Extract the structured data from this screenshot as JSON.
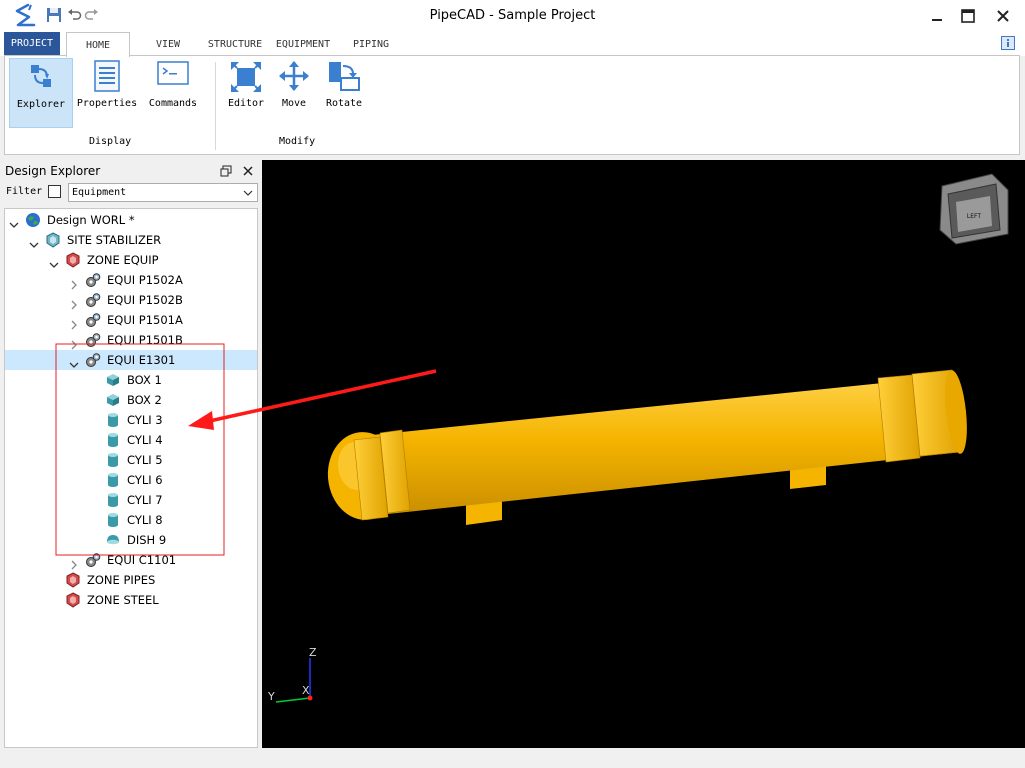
{
  "window": {
    "title": "PipeCAD - Sample Project"
  },
  "tabs": [
    {
      "label": "PROJECT"
    },
    {
      "label": "HOME"
    },
    {
      "label": "VIEW"
    },
    {
      "label": "STRUCTURE"
    },
    {
      "label": "EQUIPMENT"
    },
    {
      "label": "PIPING"
    }
  ],
  "ribbon": {
    "display_group": "Display",
    "modify_group": "Modify",
    "buttons": {
      "explorer": "Explorer",
      "properties": "Properties",
      "commands": "Commands",
      "editor": "Editor",
      "move": "Move",
      "rotate": "Rotate"
    }
  },
  "explorer": {
    "title": "Design Explorer",
    "filter_label": "Filter",
    "filter_value": "Equipment",
    "tree": [
      {
        "label": "Design WORL *",
        "icon": "globe-icon"
      },
      {
        "label": "SITE STABILIZER",
        "icon": "site-icon"
      },
      {
        "label": "ZONE EQUIP",
        "icon": "zone-icon"
      },
      {
        "label": "EQUI P1502A",
        "icon": "equipment-icon"
      },
      {
        "label": "EQUI P1502B",
        "icon": "equipment-icon"
      },
      {
        "label": "EQUI P1501A",
        "icon": "equipment-icon"
      },
      {
        "label": "EQUI P1501B",
        "icon": "equipment-icon"
      },
      {
        "label": "EQUI E1301",
        "icon": "equipment-icon"
      },
      {
        "label": "BOX 1",
        "icon": "box-icon"
      },
      {
        "label": "BOX 2",
        "icon": "box-icon"
      },
      {
        "label": "CYLI 3",
        "icon": "cylinder-icon"
      },
      {
        "label": "CYLI 4",
        "icon": "cylinder-icon"
      },
      {
        "label": "CYLI 5",
        "icon": "cylinder-icon"
      },
      {
        "label": "CYLI 6",
        "icon": "cylinder-icon"
      },
      {
        "label": "CYLI 7",
        "icon": "cylinder-icon"
      },
      {
        "label": "CYLI 8",
        "icon": "cylinder-icon"
      },
      {
        "label": "DISH 9",
        "icon": "dish-icon"
      },
      {
        "label": "EQUI C1101",
        "icon": "equipment-icon"
      },
      {
        "label": "ZONE PIPES",
        "icon": "zone-icon"
      },
      {
        "label": "ZONE STEEL",
        "icon": "zone-icon"
      }
    ]
  },
  "viewport": {
    "view_cube_label": "LEFT",
    "axes": {
      "z": "Z",
      "y": "Y",
      "x": "X"
    },
    "model_color": "#f5b400"
  },
  "colors": {
    "accent": "#2b579a",
    "selection": "#cce8ff",
    "annotation": "#e02020"
  }
}
